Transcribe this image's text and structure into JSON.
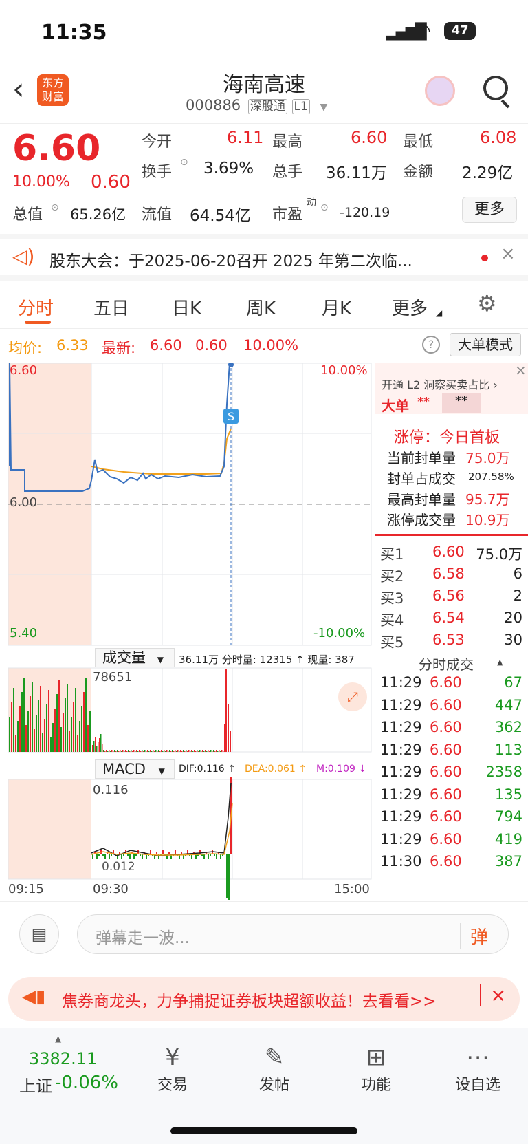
{
  "status": {
    "time": "11:35",
    "battery": "47"
  },
  "nav": {
    "title": "海南高速",
    "code": "000886",
    "badge1": "深股通",
    "badge2": "L1",
    "logo_line1": "东方",
    "logo_line2": "财富"
  },
  "quote": {
    "price": "6.60",
    "pct": "10.00%",
    "change": "0.60",
    "open_label": "今开",
    "open": "6.11",
    "high_label": "最高",
    "high": "6.60",
    "low_label": "最低",
    "low": "6.08",
    "turnover_label": "换手",
    "turnover": "3.69%",
    "volume_label": "总手",
    "volume": "36.11万",
    "amount_label": "金额",
    "amount": "2.29亿",
    "mktcap_label": "总值",
    "mktcap": "65.26亿",
    "float_label": "流值",
    "float": "64.54亿",
    "pe_label": "市盈",
    "pe_sup": "动",
    "pe": "-120.19",
    "more": "更多"
  },
  "notice": {
    "text": "股东大会：于2025-06-20召开 2025 年第二次临..."
  },
  "tabs": [
    "分时",
    "五日",
    "日K",
    "周K",
    "月K",
    "更多"
  ],
  "avgbar": {
    "avg_label": "均价:",
    "avg": "6.33",
    "latest_label": "最新:",
    "latest": "6.60",
    "chg": "0.60",
    "pct": "10.00%",
    "mode": "大单模式"
  },
  "chart": {
    "ytop": "6.60",
    "ymid": "6.00",
    "ybot": "5.40",
    "pct_top": "10.00%",
    "pct_bot": "-10.00%",
    "vol_label": "成交量",
    "vol_info": "36.11万 分时量: 12315 ↑ 现量: 387",
    "vol_max": "78651",
    "macd_label": "MACD",
    "dif": "DIF:0.116 ↑",
    "dea": "DEA:0.061 ↑",
    "m": "M:0.109 ↓",
    "macd_top": "0.116",
    "macd_low": "0.012",
    "t1": "09:15",
    "t2": "09:30",
    "t3": "15:00"
  },
  "side": {
    "l2": "开通 L2 洞察买卖占比 ›",
    "big": "大单",
    "stars": "**",
    "limit_title": "涨停：今日首板",
    "seal_label": "当前封单量",
    "seal": "75.0万",
    "seal_ratio_label": "封单占成交",
    "seal_ratio": "207.58%",
    "max_seal_label": "最高封单量",
    "max_seal": "95.7万",
    "limit_vol_label": "涨停成交量",
    "limit_vol": "10.9万",
    "bids": [
      {
        "l": "买1",
        "p": "6.60",
        "v": "75.0万"
      },
      {
        "l": "买2",
        "p": "6.58",
        "v": "6"
      },
      {
        "l": "买3",
        "p": "6.56",
        "v": "2"
      },
      {
        "l": "买4",
        "p": "6.54",
        "v": "20"
      },
      {
        "l": "买5",
        "p": "6.53",
        "v": "30"
      }
    ],
    "ticks_title": "分时成交",
    "ticks": [
      {
        "t": "11:29",
        "p": "6.60",
        "v": "67"
      },
      {
        "t": "11:29",
        "p": "6.60",
        "v": "447"
      },
      {
        "t": "11:29",
        "p": "6.60",
        "v": "362"
      },
      {
        "t": "11:29",
        "p": "6.60",
        "v": "113"
      },
      {
        "t": "11:29",
        "p": "6.60",
        "v": "2358"
      },
      {
        "t": "11:29",
        "p": "6.60",
        "v": "135"
      },
      {
        "t": "11:29",
        "p": "6.60",
        "v": "794"
      },
      {
        "t": "11:29",
        "p": "6.60",
        "v": "419"
      },
      {
        "t": "11:30",
        "p": "6.60",
        "v": "387"
      }
    ]
  },
  "danmu": {
    "placeholder": "弹幕走一波...",
    "btn": "弹"
  },
  "ad": {
    "text": "焦券商龙头，力争捕捉证券板块超额收益！去看看>>"
  },
  "bottom": {
    "index": "3382.11",
    "index_name": "上证",
    "index_pct": "-0.06%",
    "items": [
      "交易",
      "发帖",
      "功能",
      "设自选"
    ]
  },
  "colors": {
    "up": "#e8262b",
    "down": "#1a9a1f",
    "accent": "#f39a12",
    "line": "#3a72c0"
  }
}
